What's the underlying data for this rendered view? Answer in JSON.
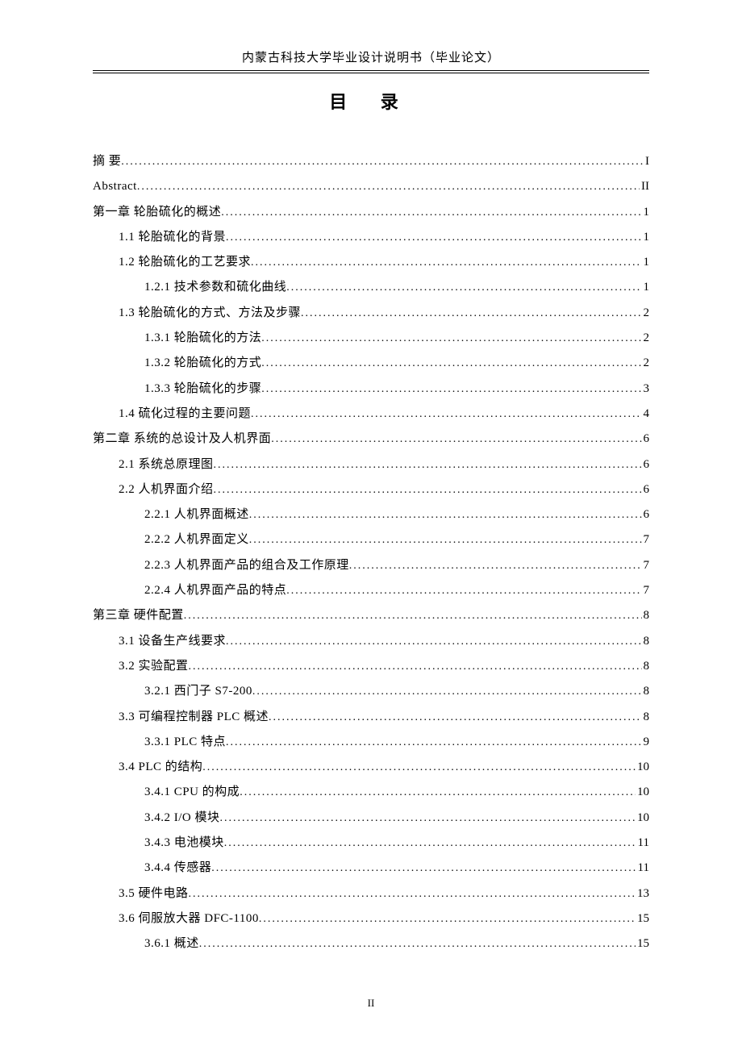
{
  "header": "内蒙古科技大学毕业设计说明书（毕业论文）",
  "title": "目 录",
  "footer": "II",
  "toc": [
    {
      "indent": 0,
      "label": "摘  要",
      "page": "I",
      "spaced": false
    },
    {
      "indent": 0,
      "label": "Abstract",
      "page": "II"
    },
    {
      "indent": 0,
      "label": "第一章 轮胎硫化的概述",
      "page": "1"
    },
    {
      "indent": 1,
      "label": "1.1 轮胎硫化的背景",
      "page": "1"
    },
    {
      "indent": 1,
      "label": "1.2 轮胎硫化的工艺要求",
      "page": "1"
    },
    {
      "indent": 2,
      "label": "1.2.1 技术参数和硫化曲线",
      "page": "1"
    },
    {
      "indent": 1,
      "label": "1.3 轮胎硫化的方式、方法及步骤",
      "page": "2"
    },
    {
      "indent": 2,
      "label": "1.3.1 轮胎硫化的方法",
      "page": "2"
    },
    {
      "indent": 2,
      "label": "1.3.2 轮胎硫化的方式",
      "page": "2"
    },
    {
      "indent": 2,
      "label": "1.3.3 轮胎硫化的步骤",
      "page": "3"
    },
    {
      "indent": 1,
      "label": "1.4 硫化过程的主要问题",
      "page": "4"
    },
    {
      "indent": 0,
      "label": "第二章 系统的总设计及人机界面",
      "page": "6"
    },
    {
      "indent": 1,
      "label": "2.1 系统总原理图",
      "page": "6"
    },
    {
      "indent": 1,
      "label": "2.2 人机界面介绍",
      "page": "6"
    },
    {
      "indent": 2,
      "label": "2.2.1 人机界面概述",
      "page": "6"
    },
    {
      "indent": 2,
      "label": "2.2.2 人机界面定义",
      "page": "7"
    },
    {
      "indent": 2,
      "label": "2.2.3 人机界面产品的组合及工作原理",
      "page": "7"
    },
    {
      "indent": 2,
      "label": "2.2.4 人机界面产品的特点",
      "page": "7"
    },
    {
      "indent": 0,
      "label": "第三章 硬件配置",
      "page": "8"
    },
    {
      "indent": 1,
      "label": "3.1 设备生产线要求",
      "page": "8"
    },
    {
      "indent": 1,
      "label": "3.2 实验配置",
      "page": "8"
    },
    {
      "indent": 2,
      "label": "3.2.1 西门子 S7-200",
      "page": "8"
    },
    {
      "indent": 1,
      "label": "3.3 可编程控制器 PLC 概述",
      "page": "8"
    },
    {
      "indent": 2,
      "label": "3.3.1 PLC 特点",
      "page": "9"
    },
    {
      "indent": 1,
      "label": "3.4 PLC 的结构",
      "page": "10"
    },
    {
      "indent": 2,
      "label": "3.4.1 CPU 的构成",
      "page": "10"
    },
    {
      "indent": 2,
      "label": "3.4.2 I/O 模块",
      "page": "10"
    },
    {
      "indent": 2,
      "label": "3.4.3 电池模块",
      "page": "11"
    },
    {
      "indent": 2,
      "label": "3.4.4 传感器",
      "page": "11"
    },
    {
      "indent": 1,
      "label": "3.5 硬件电路",
      "page": "13"
    },
    {
      "indent": 1,
      "label": "3.6 伺服放大器 DFC-1100",
      "page": "15"
    },
    {
      "indent": 2,
      "label": "3.6.1 概述",
      "page": "15"
    }
  ]
}
